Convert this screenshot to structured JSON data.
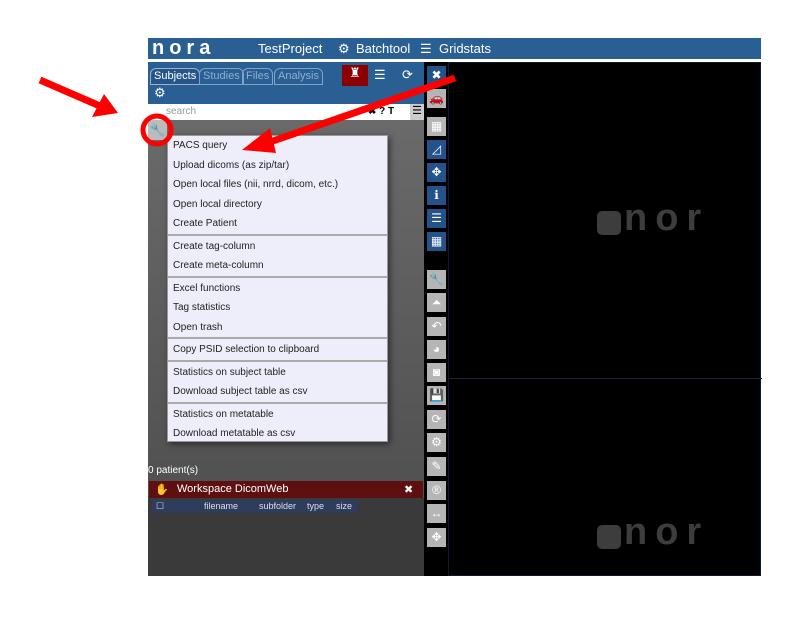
{
  "topbar": {
    "logo": "nora",
    "project": "TestProject",
    "batchtool": "Batchtool",
    "gridstats": "Gridstats"
  },
  "tabs": [
    "Subjects",
    "Studies",
    "Files",
    "Analysis"
  ],
  "search": {
    "placeholder": "search"
  },
  "menu": {
    "groups": [
      [
        "PACS query",
        "Upload dicoms (as zip/tar)",
        "Open local files (nii, nrrd, dicom, etc.)",
        "Open local directory",
        "Create Patient"
      ],
      [
        "Create tag-column",
        "Create meta-column"
      ],
      [
        "Excel functions",
        "Tag statistics",
        "Open trash"
      ],
      [
        "Copy PSID selection to clipboard"
      ],
      [
        "Statistics on subject table",
        "Download subject table as csv"
      ],
      [
        "Statistics on metatable",
        "Download metatable as csv"
      ]
    ]
  },
  "status": {
    "patients": "0 patient(s)"
  },
  "workspace": {
    "title": "Workspace  DicomWeb",
    "columns": [
      "filename",
      "subfolder",
      "type",
      "size"
    ]
  },
  "viewer": {
    "watermark": "nor"
  },
  "colors": {
    "header": "#2a5f93",
    "workspace": "#5e1010",
    "annotation": "#ff0000"
  }
}
